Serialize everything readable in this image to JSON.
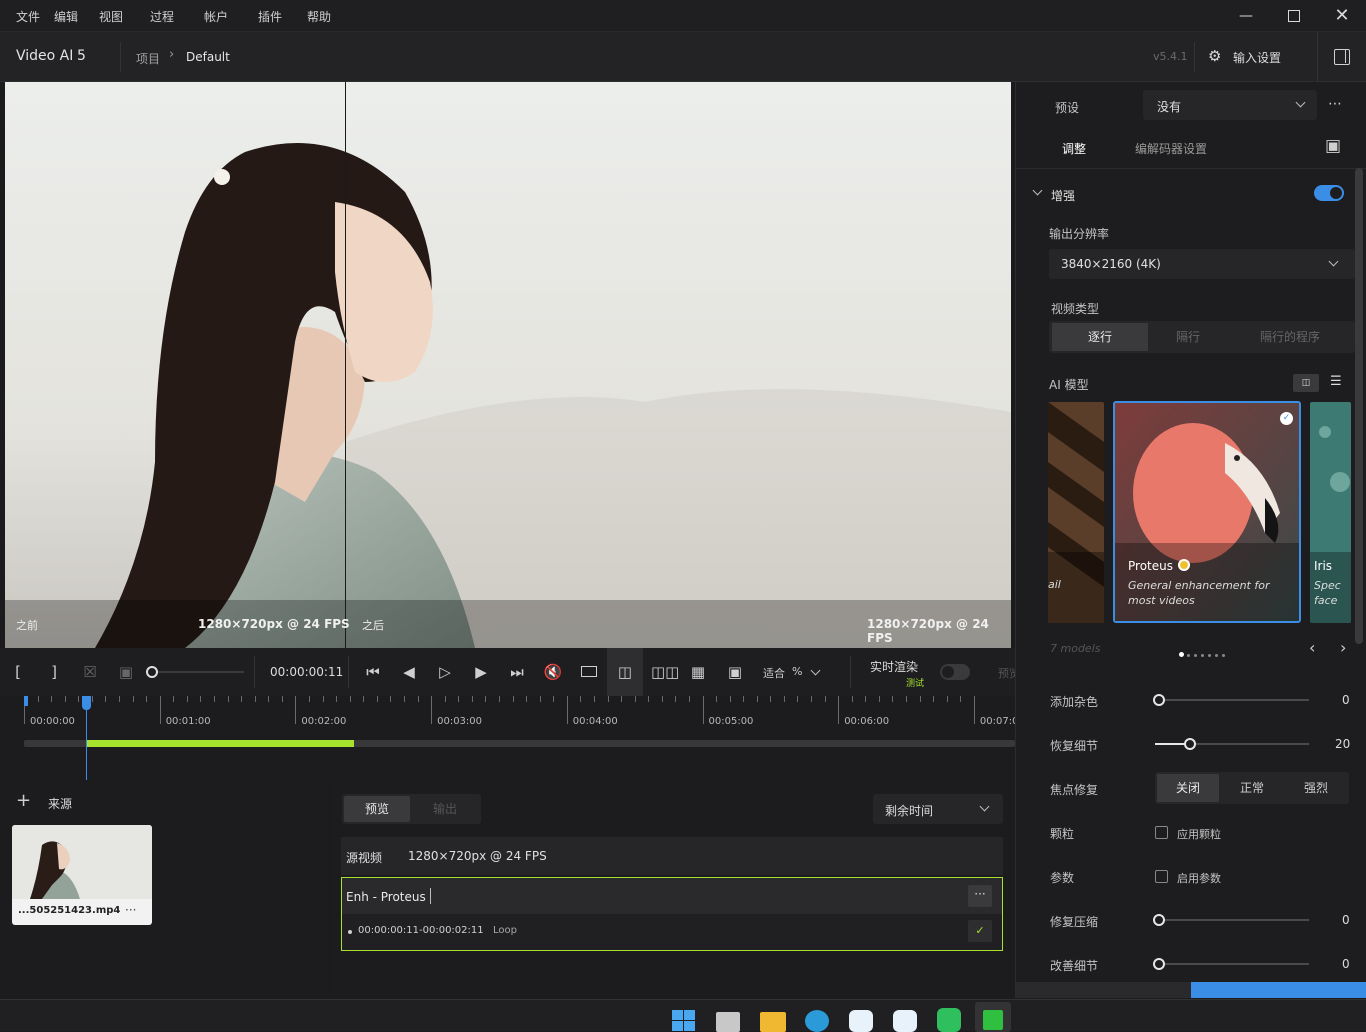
{
  "menu": {
    "items": [
      "文件",
      "编辑",
      "视图",
      "过程",
      "帐户",
      "插件",
      "帮助"
    ]
  },
  "window": {
    "minimize_icon": "minimize-icon",
    "maximize_icon": "maximize-icon",
    "close_icon": "close-icon"
  },
  "titlebar": {
    "app_name": "Video AI",
    "app_version_major": "5",
    "breadcrumb_root": "项目",
    "breadcrumb_current": "Default",
    "version": "v5.4.1",
    "settings_label": "输入设置"
  },
  "viewer": {
    "before_label": "之前",
    "before_info": "1280×720px @ 24 FPS",
    "after_label": "之后",
    "after_info": "1280×720px @ 24 FPS"
  },
  "controls": {
    "timecode": "00:00:00:11",
    "zoom_label": "适合",
    "zoom_unit": "%",
    "realtime_label": "实时渲染",
    "realtime_badge": "测试",
    "preview_cut": "预览"
  },
  "timeline": {
    "ticks": [
      "00:00:00",
      "00:01:00",
      "00:02:00",
      "00:03:00",
      "00:04:00",
      "00:05:00",
      "00:06:00",
      "00:07:0"
    ],
    "progress_fraction": 0.27
  },
  "sources": {
    "add_icon": "plus-icon",
    "label": "来源",
    "file_name": "...505251423.mp4",
    "more": "···"
  },
  "queue": {
    "tab_preview": "预览",
    "tab_output": "输出",
    "sort_label": "剩余时间",
    "source_label": "源视频",
    "source_info": "1280×720px @ 24 FPS",
    "job_title": "Enh - Proteus",
    "job_range": "00:00:00:11-00:00:02:11",
    "job_loop": "Loop",
    "more": "···"
  },
  "panel": {
    "preset_label": "预设",
    "preset_value": "没有",
    "tab_adjust": "调整",
    "tab_codec": "编解码器设置",
    "section_enhance": "增强",
    "output_res_label": "输出分辨率",
    "output_res_value": "3840×2160 (4K)",
    "video_type_label": "视频类型",
    "video_type_options": [
      "逐行",
      "隔行",
      "隔行的程序"
    ],
    "ai_model_label": "AI 模型",
    "model_main_name": "Proteus",
    "model_main_desc": "General enhancement for most videos",
    "model_left_name": "ail",
    "model_right_name": "Iris",
    "model_right_desc": "Spec face",
    "models_count": "7 models",
    "sliders": [
      {
        "label": "添加杂色",
        "value": "0",
        "fraction": 0
      },
      {
        "label": "恢复细节",
        "value": "20",
        "fraction": 0.2
      }
    ],
    "focus_label": "焦点修复",
    "focus_options": [
      "关闭",
      "正常",
      "强烈"
    ],
    "grain_label": "颗粒",
    "grain_checkbox": "应用颗粒",
    "params_label": "参数",
    "params_checkbox": "启用参数",
    "sliders2": [
      {
        "label": "修复压缩",
        "value": "0",
        "fraction": 0
      },
      {
        "label": "改善细节",
        "value": "0",
        "fraction": 0
      }
    ]
  },
  "colors": {
    "accent": "#3a8ee6",
    "green": "#a6e22e",
    "bg": "#1b1b1d"
  }
}
